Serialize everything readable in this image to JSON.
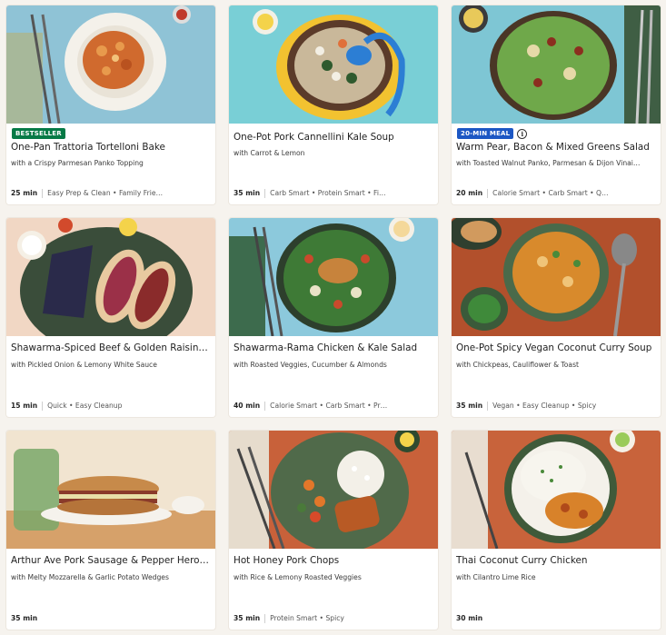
{
  "recipes": [
    {
      "badge": "BESTSELLER",
      "title": "One-Pan Trattoria Tortelloni Bake",
      "subtitle": "with a Crispy Parmesan Panko Topping",
      "time": "25 min",
      "tags": "Easy Prep & Clean • Family Frie…"
    },
    {
      "badge": "",
      "title": "One-Pot Pork Cannellini Kale Soup",
      "subtitle": "with Carrot & Lemon",
      "time": "35 min",
      "tags": "Carb Smart • Protein Smart • Fi…"
    },
    {
      "badge": "20-MIN MEAL",
      "title": "Warm Pear, Bacon & Mixed Greens Salad",
      "subtitle": "with Toasted Walnut Panko, Parmesan & Dijon Vinai…",
      "time": "20 min",
      "tags": "Calorie Smart • Carb Smart • Q…"
    },
    {
      "badge": "",
      "title": "Shawarma-Spiced Beef & Golden Raisin…",
      "subtitle": "with Pickled Onion & Lemony White Sauce",
      "time": "15 min",
      "tags": "Quick • Easy Cleanup"
    },
    {
      "badge": "",
      "title": "Shawarma-Rama Chicken & Kale Salad",
      "subtitle": "with Roasted Veggies, Cucumber & Almonds",
      "time": "40 min",
      "tags": "Calorie Smart • Carb Smart • Pr…"
    },
    {
      "badge": "",
      "title": "One-Pot Spicy Vegan Coconut Curry Soup",
      "subtitle": "with Chickpeas, Cauliflower & Toast",
      "time": "35 min",
      "tags": "Vegan • Easy Cleanup • Spicy"
    },
    {
      "badge": "",
      "title": "Arthur Ave Pork Sausage & Pepper Hero…",
      "subtitle": "with Melty Mozzarella & Garlic Potato Wedges",
      "time": "35 min",
      "tags": ""
    },
    {
      "badge": "",
      "title": "Hot Honey Pork Chops",
      "subtitle": "with Rice & Lemony Roasted Veggies",
      "time": "35 min",
      "tags": "Protein Smart • Spicy"
    },
    {
      "badge": "",
      "title": "Thai Coconut Curry Chicken",
      "subtitle": "with Cilantro Lime Rice",
      "time": "30 min",
      "tags": ""
    }
  ],
  "badge_colors": {
    "BESTSELLER": "#067a46",
    "20-MIN MEAL": "#1c57c4"
  },
  "icons": {
    "info": "info-icon"
  }
}
